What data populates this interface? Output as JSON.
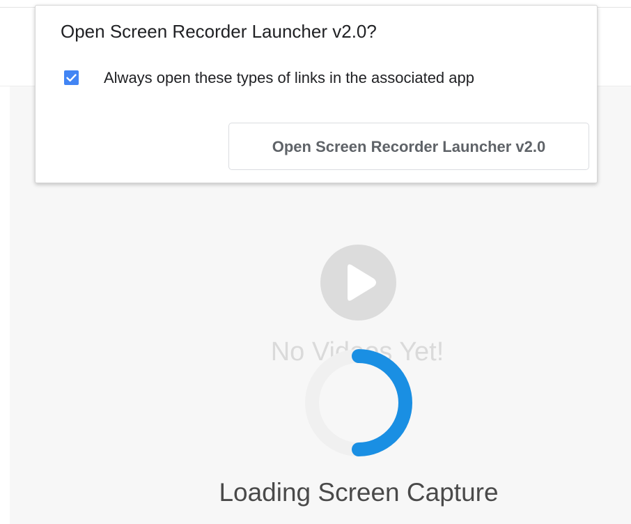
{
  "dialog": {
    "title": "Open Screen Recorder Launcher v2.0?",
    "checkbox_label": "Always open these types of links in the associated app",
    "checkbox_checked": true,
    "open_button_label": "Open Screen Recorder Launcher v2.0"
  },
  "empty_state": {
    "message": "No Videos Yet!",
    "icon": "play-icon"
  },
  "loading": {
    "message": "Loading Screen Capture"
  },
  "colors": {
    "accent": "#4285f4",
    "spinner": "#1a8fe3",
    "spinner_track": "#f0f0f0",
    "play_circle": "#dcdcdc"
  }
}
